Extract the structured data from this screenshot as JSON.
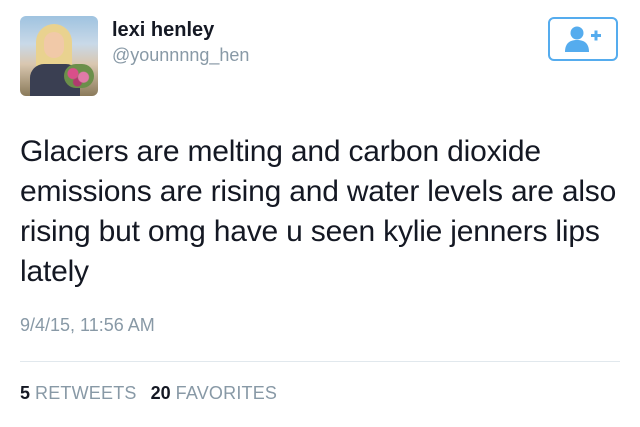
{
  "user": {
    "name": "lexi henley",
    "handle": "@younnnng_hen"
  },
  "follow_button": {
    "icon": "add-user-icon",
    "accent_color": "#55acee"
  },
  "tweet": {
    "text": "Glaciers are melting and carbon dioxide emissions are rising and water levels are also rising but omg have u seen kylie jenners lips lately",
    "timestamp": "9/4/15, 11:56 AM"
  },
  "stats": {
    "retweets_count": "5",
    "retweets_label": "RETWEETS",
    "favorites_count": "20",
    "favorites_label": "FAVORITES"
  }
}
